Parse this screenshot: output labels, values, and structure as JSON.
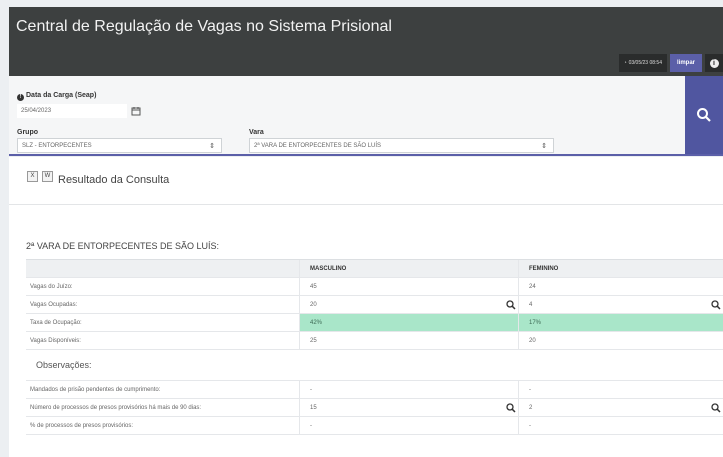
{
  "header": {
    "title": "Central de Regulação de Vagas no Sistema Prisional",
    "timestamp": "03/05/23 08:54",
    "clear_label": "limpar",
    "info_label": "i"
  },
  "filters": {
    "data_carga_label": "Data da Carga (Seap)",
    "data_carga_value": "25/04/2023",
    "grupo_label": "Grupo",
    "grupo_value": "SLZ - ENTORPECENTES",
    "vara_label": "Vara",
    "vara_value": "2ª VARA DE ENTORPECENTES DE SÃO LUÍS"
  },
  "result": {
    "title": "Resultado da Consulta",
    "section_title": "2ª VARA DE ENTORPECENTES DE SÃO LUÍS:",
    "columns": [
      "",
      "MASCULINO",
      "FEMININO"
    ],
    "rows": [
      {
        "label": "Vagas do Juízo:",
        "m": "45",
        "f": "24"
      },
      {
        "label": "Vagas Ocupadas:",
        "m": "20",
        "f": "4"
      },
      {
        "label": "Taxa de Ocupação:",
        "m": "42%",
        "f": "17%"
      },
      {
        "label": "Vagas Disponíveis:",
        "m": "25",
        "f": "20"
      }
    ],
    "observacoes_label": "Observações:",
    "obs_rows": [
      {
        "label": "Mandados de prisão pendentes de cumprimento:",
        "m": "-",
        "f": "-"
      },
      {
        "label": "Número de processos de presos provisórios há mais de 90 dias:",
        "m": "15",
        "f": "2"
      },
      {
        "label": "% de processos de presos provisórios:",
        "m": "-",
        "f": "-"
      }
    ]
  },
  "colors": {
    "accent": "#5056a0",
    "header_bg": "#3d4040",
    "highlight": "#a9e6c9"
  }
}
